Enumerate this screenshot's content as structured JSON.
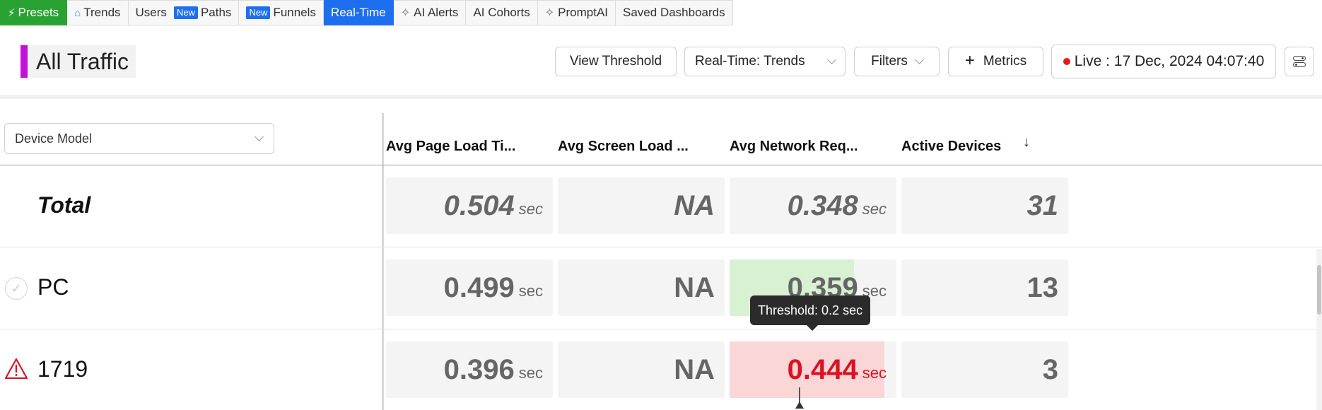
{
  "nav": {
    "presets": "Presets",
    "trends": "Trends",
    "users": "Users",
    "paths_badge": "New",
    "paths": "Paths",
    "funnels_badge": "New",
    "funnels": "Funnels",
    "realtime": "Real-Time",
    "ai_alerts": "AI Alerts",
    "ai_cohorts": "AI Cohorts",
    "promptai": "PromptAI",
    "saved_dashboards": "Saved Dashboards"
  },
  "header": {
    "title": "All Traffic",
    "view_threshold": "View Threshold",
    "view_select": "Real-Time: Trends",
    "filters": "Filters",
    "metrics": "Metrics",
    "live": "Live : 17 Dec, 2024 04:07:40"
  },
  "table": {
    "group_by": "Device Model",
    "columns": [
      "Avg Page Load Ti...",
      "Avg Screen Load ...",
      "Avg Network Req...",
      "Active Devices"
    ],
    "rows": [
      {
        "label": "Total",
        "page_load": "0.504",
        "screen_load": "NA",
        "network": "0.348",
        "active": "31",
        "unit": "sec"
      },
      {
        "label": "PC",
        "page_load": "0.499",
        "screen_load": "NA",
        "network": "0.359",
        "active": "13",
        "unit": "sec"
      },
      {
        "label": "1719",
        "page_load": "0.396",
        "screen_load": "NA",
        "network": "0.444",
        "active": "3",
        "unit": "sec"
      }
    ]
  },
  "tooltip": "Threshold: 0.2 sec",
  "colors": {
    "accent": "#c212d8",
    "presets_green": "#2aa232",
    "active_tab_blue": "#1e6ef0",
    "good_fill": "#d8f1d3",
    "bad_fill": "#fbd6d6",
    "alert_red": "#dc1124"
  },
  "icons": {
    "presets": "lightning-icon",
    "trends": "home-icon",
    "ai": "sparkle-icon",
    "ok": "check-circle-icon",
    "warn": "warning-triangle-icon",
    "settings": "toggle-settings-icon"
  }
}
